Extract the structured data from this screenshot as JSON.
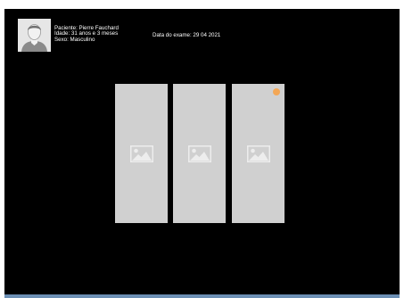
{
  "patient": {
    "name_line": "Paciente: Pierre Fauchard",
    "age_line": "Idade: 31 anos e 3 meses",
    "sex_line": "Sexo: Masculino",
    "exam_date_line": "Data do exame: 29 04 2021"
  },
  "thumbnails": [
    {
      "icon": "image-placeholder-icon",
      "badge": false
    },
    {
      "icon": "image-placeholder-icon",
      "badge": false
    },
    {
      "icon": "image-placeholder-icon",
      "badge": true
    }
  ],
  "colors": {
    "background": "#000000",
    "thumbnail": "#d0d0d0",
    "badge": "#f3a756",
    "bottom_bar": "#6c8fb4"
  }
}
